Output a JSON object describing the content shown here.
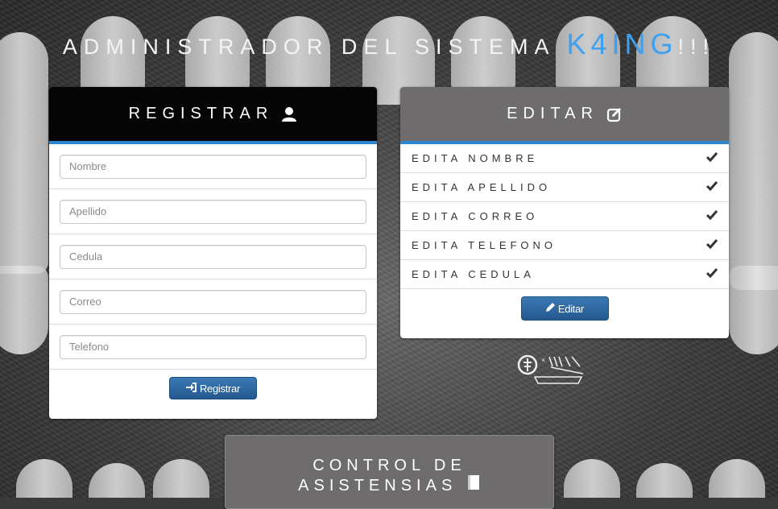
{
  "header": {
    "title_prefix": "ADMINISTRADOR DEL SISTEMA",
    "brand": "K4ING",
    "title_suffix": "!!!"
  },
  "register": {
    "title": "REGISTRAR",
    "icon": "user-icon",
    "fields": [
      {
        "placeholder": "Nombre",
        "value": ""
      },
      {
        "placeholder": "Apellido",
        "value": ""
      },
      {
        "placeholder": "Cedula",
        "value": ""
      },
      {
        "placeholder": "Correo",
        "value": ""
      },
      {
        "placeholder": "Telefono",
        "value": ""
      }
    ],
    "button_label": "Registrar",
    "button_icon": "sign-in-icon"
  },
  "edit": {
    "title": "EDITAR",
    "icon": "edit-icon",
    "items": [
      {
        "label": "EDITA NOMBRE",
        "icon": "check-icon"
      },
      {
        "label": "EDITA APELLIDO",
        "icon": "check-icon"
      },
      {
        "label": "EDITA CORREO",
        "icon": "check-icon"
      },
      {
        "label": "EDITA TELEFONO",
        "icon": "check-icon"
      },
      {
        "label": "EDITA CEDULA",
        "icon": "check-icon"
      }
    ],
    "button_label": "Editar",
    "button_icon": "pencil-icon"
  },
  "control": {
    "title_line1": "CONTROL DE",
    "title_line2": "ASISTENSIAS",
    "icon": "book-icon"
  },
  "colors": {
    "brand": "#3ea0ee",
    "accent_bar": "#2d86d0",
    "register_head": "#050505",
    "edit_head": "#6e6c6c",
    "button": "#2a64a0"
  }
}
